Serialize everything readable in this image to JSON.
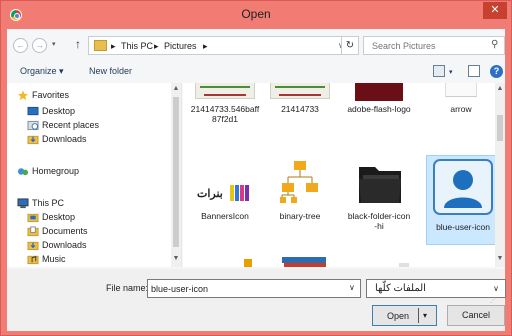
{
  "window": {
    "title": "Open",
    "close_glyph": "✕",
    "app_icon": "chrome-icon"
  },
  "nav": {
    "back_glyph": "←",
    "forward_glyph": "→",
    "recent_glyph": "▾",
    "up_glyph": "↑",
    "address_sep": "▸",
    "breadcrumbs": [
      "This PC",
      "Pictures"
    ],
    "address_drop_glyph": "∨",
    "refresh_glyph": "↻",
    "search_placeholder": "Search Pictures",
    "search_glyph": "⚲"
  },
  "toolbar": {
    "organize_label": "Organize ▾",
    "new_folder_label": "New folder",
    "help_glyph": "?"
  },
  "sidebar": {
    "items": [
      {
        "label": "Favorites",
        "icon": "star-icon"
      },
      {
        "label": "Desktop",
        "icon": "desktop-icon"
      },
      {
        "label": "Recent places",
        "icon": "recent-places-icon"
      },
      {
        "label": "Downloads",
        "icon": "downloads-icon"
      },
      {
        "label": "Homegroup",
        "icon": "homegroup-icon"
      },
      {
        "label": "This PC",
        "icon": "computer-icon"
      },
      {
        "label": "Desktop",
        "icon": "desktop-folder-icon"
      },
      {
        "label": "Documents",
        "icon": "documents-icon"
      },
      {
        "label": "Downloads",
        "icon": "downloads-icon"
      },
      {
        "label": "Music",
        "icon": "music-icon"
      }
    ]
  },
  "files": [
    {
      "name": "21414733.546baff\n87f2d1",
      "icon": "image-thumbnail-icon"
    },
    {
      "name": "21414733",
      "icon": "image-thumbnail-icon"
    },
    {
      "name": "adobe-flash-logo",
      "icon": "flash-logo-thumbnail"
    },
    {
      "name": "arrow",
      "icon": "arrow-thumbnail"
    },
    {
      "name": "BannersIcon",
      "icon": "banners-thumbnail"
    },
    {
      "name": "binary-tree",
      "icon": "binary-tree-thumbnail"
    },
    {
      "name": "black-folder-icon\n-hi",
      "icon": "black-folder-thumbnail"
    },
    {
      "name": "blue-user-icon",
      "icon": "blue-user-thumbnail",
      "selected": true
    },
    {
      "name": "",
      "icon": "image-thumbnail-icon"
    },
    {
      "name": "",
      "icon": "books-thumbnail"
    },
    {
      "name": "",
      "icon": "image-thumbnail-icon"
    },
    {
      "name": "",
      "icon": "screenshot-thumbnail"
    }
  ],
  "banner_thumb_text": "بنرات",
  "footer": {
    "file_name_label": "File name:",
    "file_name_value": "blue-user-icon",
    "file_type_value": "الملفات كلّها",
    "drop_glyph": "∨",
    "open_label": "Open",
    "open_drop_glyph": "▾",
    "cancel_label": "Cancel"
  },
  "colors": {
    "titlebar": "#f07c74",
    "selection": "#cce8ff",
    "accent": "#3c7fb1"
  }
}
